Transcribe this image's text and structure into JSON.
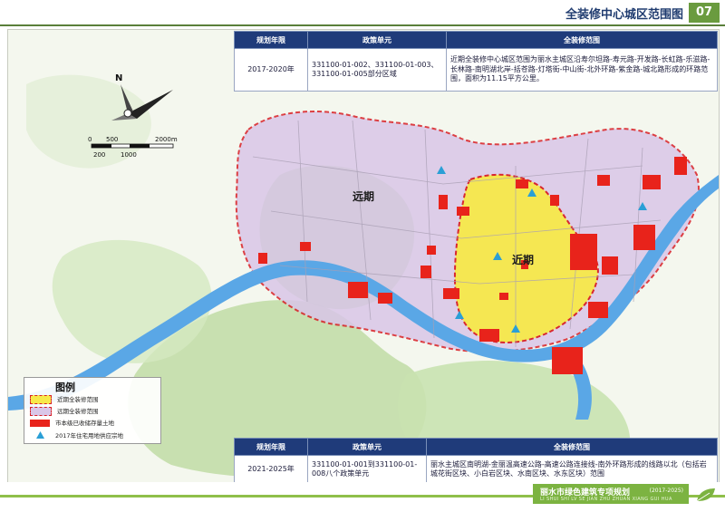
{
  "header": {
    "title": "全装修中心城区范围图",
    "page_number": "07"
  },
  "table_top": {
    "headers": [
      "规划年限",
      "政策单元",
      "全装修范围"
    ],
    "row": {
      "years": "2017-2020年",
      "units": "331100-01-002、331100-01-003、331100-01-005部分区域",
      "scope": "近期全装修中心城区范围为丽水主城区沿寿尔坦路-寿元路-开发路-长虹路-乐滋路-长林路-南明湖北岸-括苍路-灯塔街-中山街-北外环路-紫金路-城北路形成的环路范围，面积为11.15平方公里。"
    }
  },
  "table_bottom": {
    "headers": [
      "规划年限",
      "政策单元",
      "全装修范围"
    ],
    "row": {
      "years": "2021-2025年",
      "units": "331100-01-001到331100-01-008八个政策单元",
      "scope": "丽水主城区南明湖-金丽温高速公路-高速公路连接线-南外环路形成的线路以北（包括岩城花街区块、小白岩区块、水南区块、水东区块）范围"
    }
  },
  "map": {
    "north": "N",
    "scale_top": [
      "0",
      "500",
      "2000m"
    ],
    "scale_bottom": [
      "200",
      "1000"
    ],
    "label_far": "远期",
    "label_near": "近期"
  },
  "legend": {
    "title": "图例",
    "items": [
      {
        "label": "近期全装修范围",
        "color": "#f7e94a"
      },
      {
        "label": "远期全装修范围",
        "color": "#d9c6e8"
      },
      {
        "label": "市本级已收储存量土地",
        "color": "#e8231b"
      },
      {
        "label": "2017年住宅用地供应宗地",
        "color": "#2a9fd6"
      }
    ]
  },
  "footer": {
    "title": "丽水市绿色建筑专项规划",
    "year": "(2017-2025)",
    "subtitle": "LI SHUI SHI LV SE JIAN ZHU ZHUAN XIANG GUI HUA"
  }
}
